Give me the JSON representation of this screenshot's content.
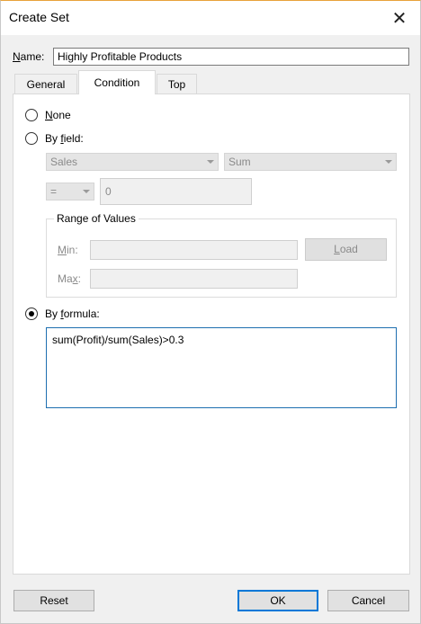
{
  "window": {
    "title": "Create Set",
    "close_glyph": "✕"
  },
  "name": {
    "label_mnemonic": "N",
    "label_rest": "ame:",
    "value": "Highly Profitable Products"
  },
  "tabs": [
    {
      "label": "General",
      "active": false
    },
    {
      "label": "Condition",
      "active": true
    },
    {
      "label": "Top",
      "active": false
    }
  ],
  "condition": {
    "none": {
      "mnemonic": "N",
      "rest": "one",
      "checked": false
    },
    "by_field": {
      "pre": "By ",
      "mnemonic": "f",
      "rest": "ield:",
      "checked": false,
      "field_value": "Sales",
      "aggregation_value": "Sum",
      "operator_value": "=",
      "compare_value": "0"
    },
    "range": {
      "title": "Range of Values",
      "min_mnemonic": "M",
      "min_rest": "in:",
      "max_pre": "Ma",
      "max_mnemonic": "x",
      "max_rest": ":",
      "load_mnemonic": "L",
      "load_rest": "oad"
    },
    "by_formula": {
      "pre": "By ",
      "mnemonic": "f",
      "rest": "ormula:",
      "checked": true,
      "formula": "sum(Profit)/sum(Sales)>0.3"
    }
  },
  "buttons": {
    "reset": "Reset",
    "ok": "OK",
    "cancel": "Cancel"
  }
}
